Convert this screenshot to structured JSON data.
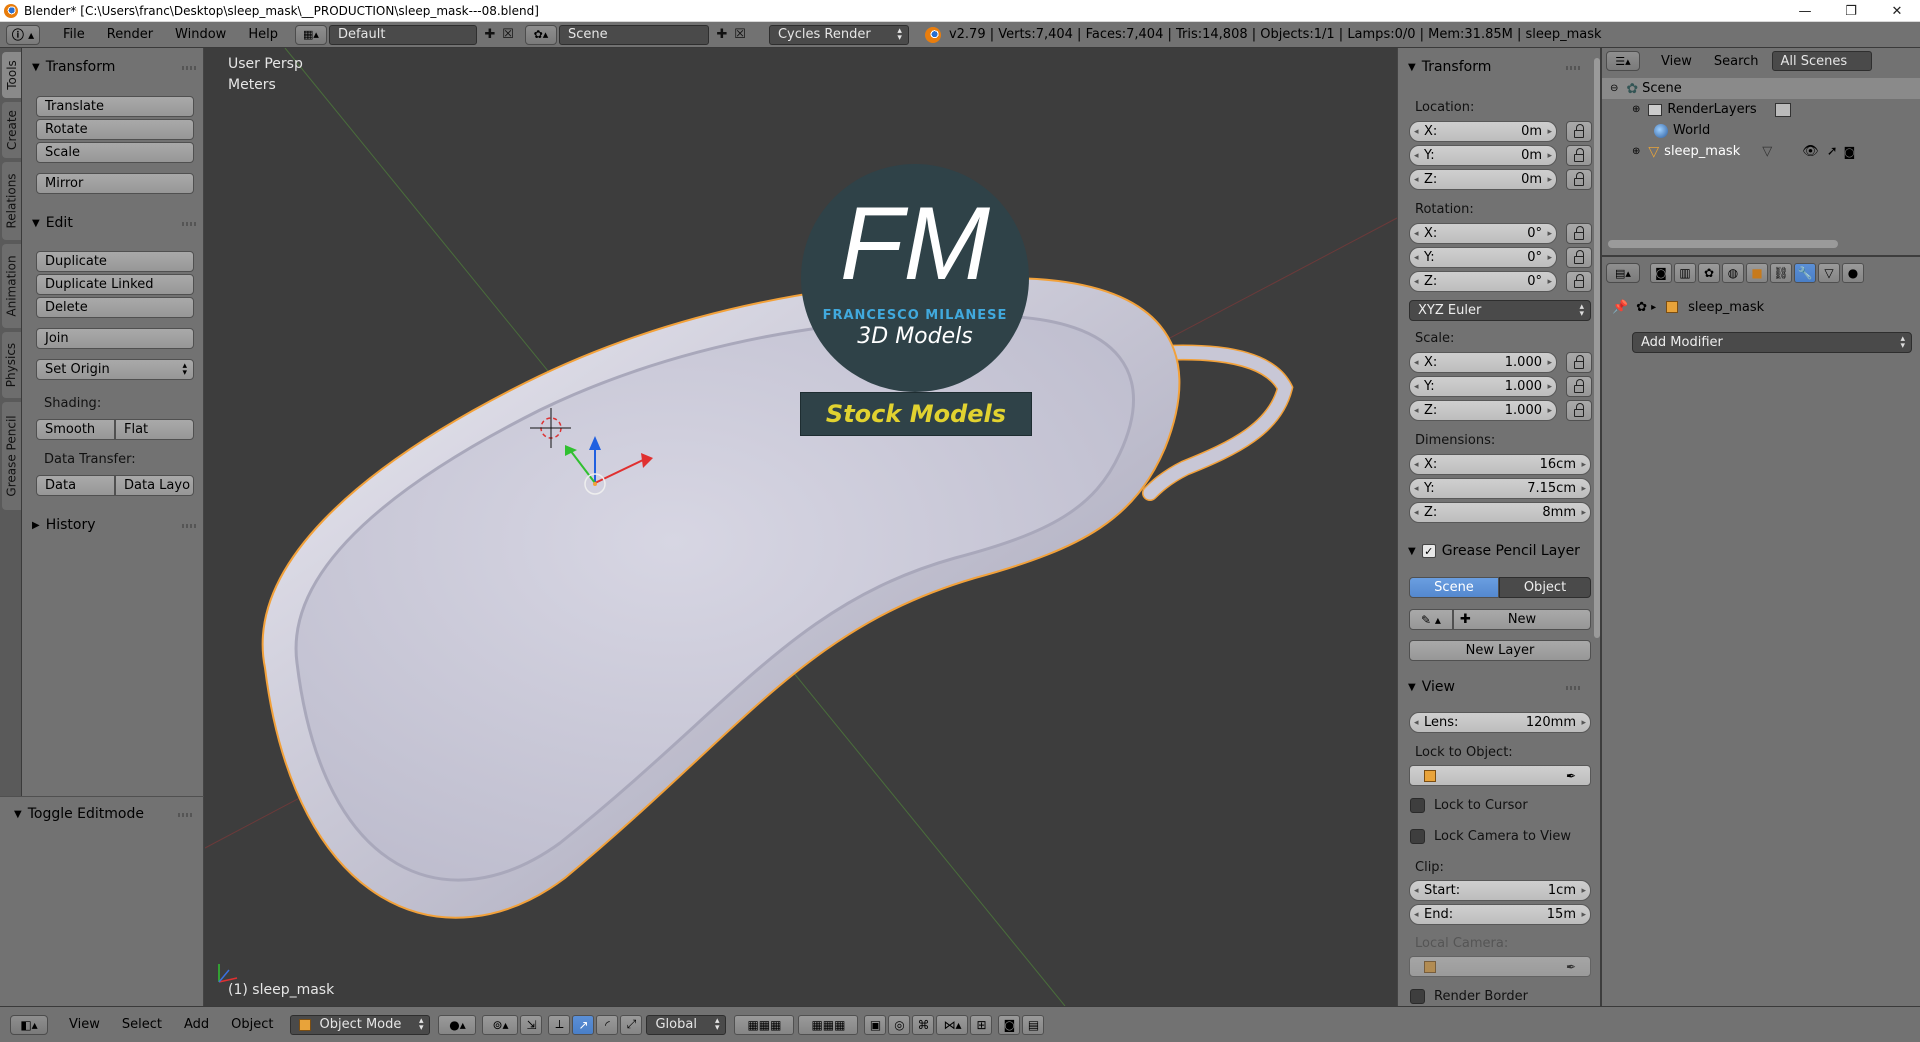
{
  "window": {
    "title": "Blender* [C:\\Users\\franc\\Desktop\\sleep_mask\\__PRODUCTION\\sleep_mask---08.blend]",
    "controls": [
      "—",
      "❐",
      "✕"
    ]
  },
  "info_header": {
    "menus": [
      "File",
      "Render",
      "Window",
      "Help"
    ],
    "layout": "Default",
    "scene": "Scene",
    "engine": "Cycles Render",
    "stats": "v2.79 | Verts:7,404 | Faces:7,404 | Tris:14,808 | Objects:1/1 | Lamps:0/0 | Mem:31.85M | sleep_mask"
  },
  "tool_tabs": [
    "Tools",
    "Create",
    "Relations",
    "Animation",
    "Physics",
    "Grease Pencil"
  ],
  "tool_shelf": {
    "transform": {
      "title": "Transform",
      "buttons": [
        "Translate",
        "Rotate",
        "Scale",
        "Mirror"
      ]
    },
    "edit": {
      "title": "Edit",
      "buttons": [
        "Duplicate",
        "Duplicate Linked",
        "Delete",
        "Join"
      ],
      "set_origin": "Set Origin",
      "shading_label": "Shading:",
      "shading": [
        "Smooth",
        "Flat"
      ],
      "data_transfer_label": "Data Transfer:",
      "data_transfer": [
        "Data",
        "Data Layo"
      ]
    },
    "history": "History",
    "last_operator": "Toggle Editmode"
  },
  "viewport": {
    "view_name": "User Persp",
    "units": "Meters",
    "object_label": "(1) sleep_mask",
    "logo": {
      "initials": "FM",
      "name": "FRANCESCO MILANESE",
      "tagline": "3D Models",
      "banner": "Stock Models"
    }
  },
  "n_panel": {
    "transform_title": "Transform",
    "location_label": "Location:",
    "location": [
      {
        "axis": "X:",
        "value": "0m"
      },
      {
        "axis": "Y:",
        "value": "0m"
      },
      {
        "axis": "Z:",
        "value": "0m"
      }
    ],
    "rotation_label": "Rotation:",
    "rotation": [
      {
        "axis": "X:",
        "value": "0°"
      },
      {
        "axis": "Y:",
        "value": "0°"
      },
      {
        "axis": "Z:",
        "value": "0°"
      }
    ],
    "rotation_mode": "XYZ Euler",
    "scale_label": "Scale:",
    "scale": [
      {
        "axis": "X:",
        "value": "1.000"
      },
      {
        "axis": "Y:",
        "value": "1.000"
      },
      {
        "axis": "Z:",
        "value": "1.000"
      }
    ],
    "dimensions_label": "Dimensions:",
    "dimensions": [
      {
        "axis": "X:",
        "value": "16cm"
      },
      {
        "axis": "Y:",
        "value": "7.15cm"
      },
      {
        "axis": "Z:",
        "value": "8mm"
      }
    ],
    "grease_pencil": {
      "title": "Grease Pencil Layer",
      "scene": "Scene",
      "object": "Object",
      "new": "New",
      "new_layer": "New Layer"
    },
    "view": {
      "title": "View",
      "lens_label": "Lens:",
      "lens_value": "120mm",
      "lock_to_object": "Lock to Object:",
      "lock_to_cursor": "Lock to Cursor",
      "lock_camera": "Lock Camera to View",
      "clip_label": "Clip:",
      "clip_start_label": "Start:",
      "clip_start": "1cm",
      "clip_end_label": "End:",
      "clip_end": "15m",
      "local_camera": "Local Camera:",
      "render_border": "Render Border"
    }
  },
  "outliner": {
    "menus": [
      "View",
      "Search"
    ],
    "filter": "All Scenes",
    "tree": [
      "Scene",
      "RenderLayers",
      "World",
      "sleep_mask"
    ]
  },
  "properties": {
    "object_name": "sleep_mask",
    "add_modifier": "Add Modifier"
  },
  "view3d_header": {
    "menus": [
      "View",
      "Select",
      "Add",
      "Object"
    ],
    "mode": "Object Mode",
    "orientation": "Global"
  },
  "colors": {
    "panel": "#727272",
    "viewport": "#3d3d3d",
    "accent_blue": "#5b8fd6",
    "selection_orange": "#f2a13a"
  }
}
